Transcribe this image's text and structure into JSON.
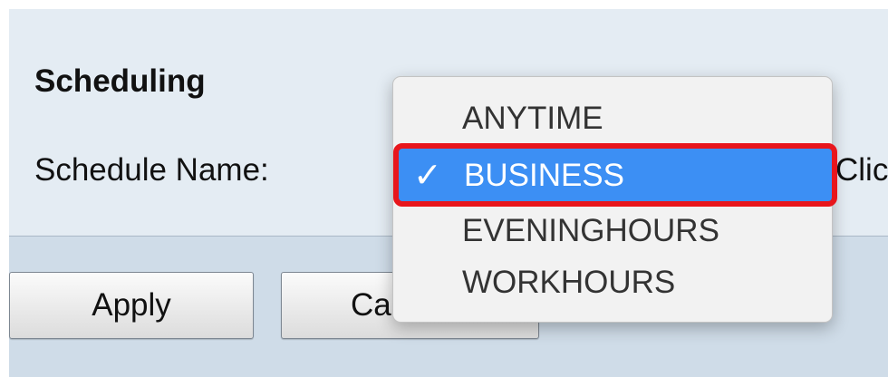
{
  "scheduling": {
    "title": "Scheduling",
    "schedule_name_label": "Schedule Name:",
    "hint_text_partial": "Clic"
  },
  "dropdown": {
    "options": [
      "ANYTIME",
      "BUSINESS",
      "EVENINGHOURS",
      "WORKHOURS"
    ],
    "selected_index": 1,
    "selected_value": "BUSINESS",
    "checkmark": "✓",
    "highlight_color": "#3c8ff4",
    "annotation_border_color": "#e8161c"
  },
  "buttons": {
    "apply_label": "Apply",
    "cancel_label_partial": "Ca"
  }
}
